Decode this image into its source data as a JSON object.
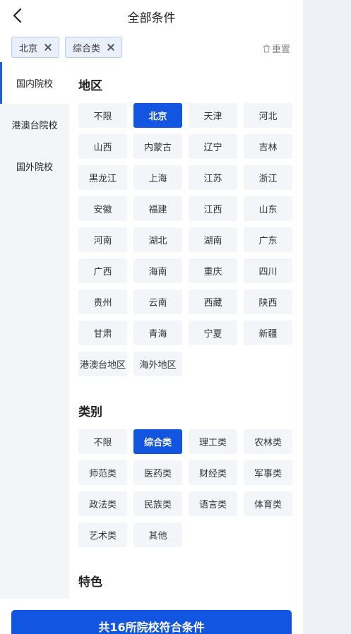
{
  "header": {
    "title": "全部条件"
  },
  "selected_chips": [
    {
      "label": "北京"
    },
    {
      "label": "综合类"
    }
  ],
  "reset": {
    "label": "重置"
  },
  "sidebar": {
    "items": [
      {
        "label": "国内院校"
      },
      {
        "label": "港澳台院校"
      },
      {
        "label": "国外院校"
      }
    ]
  },
  "region": {
    "title": "地区",
    "options": [
      "不限",
      "北京",
      "天津",
      "河北",
      "山西",
      "内蒙古",
      "辽宁",
      "吉林",
      "黑龙江",
      "上海",
      "江苏",
      "浙江",
      "安徽",
      "福建",
      "江西",
      "山东",
      "河南",
      "湖北",
      "湖南",
      "广东",
      "广西",
      "海南",
      "重庆",
      "四川",
      "贵州",
      "云南",
      "西藏",
      "陕西",
      "甘肃",
      "青海",
      "宁夏",
      "新疆",
      "港澳台地区",
      "海外地区"
    ],
    "selected": "北京"
  },
  "category": {
    "title": "类别",
    "options": [
      "不限",
      "综合类",
      "理工类",
      "农林类",
      "师范类",
      "医药类",
      "财经类",
      "军事类",
      "政法类",
      "民族类",
      "语言类",
      "体育类",
      "艺术类",
      "其他"
    ],
    "selected": "综合类"
  },
  "feature": {
    "title": "特色"
  },
  "submit": {
    "label": "共16所院校符合条件"
  },
  "colors": {
    "accent": "#1255e0",
    "chip_bg": "#e9f0fb",
    "option_bg": "#f4f5f8",
    "sidebar_bg": "#f3f5f9"
  }
}
